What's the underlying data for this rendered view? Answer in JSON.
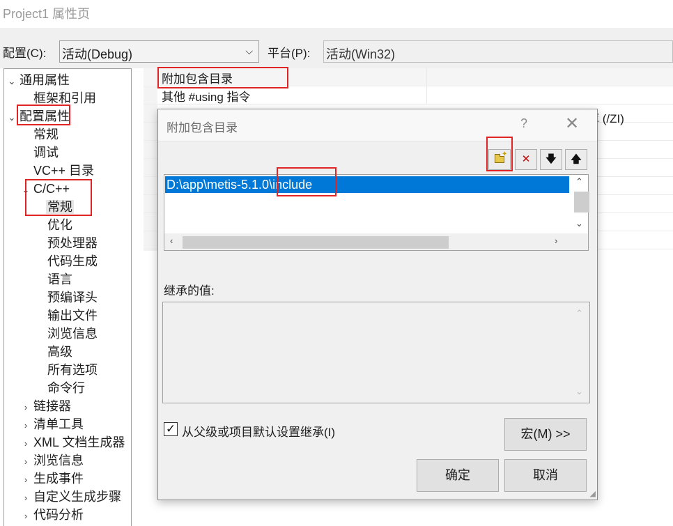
{
  "window": {
    "title": "Project1 属性页"
  },
  "config": {
    "config_label": "配置(C):",
    "config_value": "活动(Debug)",
    "platform_label": "平台(P):",
    "platform_value": "活动(Win32)"
  },
  "tree": {
    "items": [
      {
        "label": "通用属性",
        "chevron": "⌄"
      },
      {
        "label": "框架和引用"
      },
      {
        "label": "配置属性",
        "chevron": "⌄"
      },
      {
        "label": "常规"
      },
      {
        "label": "调试"
      },
      {
        "label": "VC++ 目录"
      },
      {
        "label": "C/C++",
        "chevron": "⌄"
      },
      {
        "label": "常规"
      },
      {
        "label": "优化"
      },
      {
        "label": "预处理器"
      },
      {
        "label": "代码生成"
      },
      {
        "label": "语言"
      },
      {
        "label": "预编译头"
      },
      {
        "label": "输出文件"
      },
      {
        "label": "浏览信息"
      },
      {
        "label": "高级"
      },
      {
        "label": "所有选项"
      },
      {
        "label": "命令行"
      },
      {
        "label": "链接器",
        "chevron": "›"
      },
      {
        "label": "清单工具",
        "chevron": "›"
      },
      {
        "label": "XML 文档生成器",
        "chevron": "›"
      },
      {
        "label": "浏览信息",
        "chevron": "›"
      },
      {
        "label": "生成事件",
        "chevron": "›"
      },
      {
        "label": "自定义生成步骤",
        "chevron": "›"
      },
      {
        "label": "代码分析",
        "chevron": "›"
      }
    ]
  },
  "grid": {
    "rows": [
      {
        "name": "附加包含目录"
      },
      {
        "name": "其他 #using 指令"
      }
    ],
    "behind_partial_text": "库 (/ZI)"
  },
  "dialog": {
    "title": "附加包含目录",
    "help": "?",
    "close": "✕",
    "toolbar": {
      "delete": "✕",
      "down": "🡇",
      "up": "🡅"
    },
    "list_items": [
      "D:\\app\\metis-5.1.0\\include"
    ],
    "inherited_label": "继承的值:",
    "inherit_checkbox_checked": "✓",
    "inherit_checkbox_label": "从父级或项目默认设置继承(I)",
    "macro_button": "宏(M) >>",
    "ok_button": "确定",
    "cancel_button": "取消"
  },
  "colors": {
    "selection": "#0078d7",
    "highlight_box": "#e02424"
  }
}
